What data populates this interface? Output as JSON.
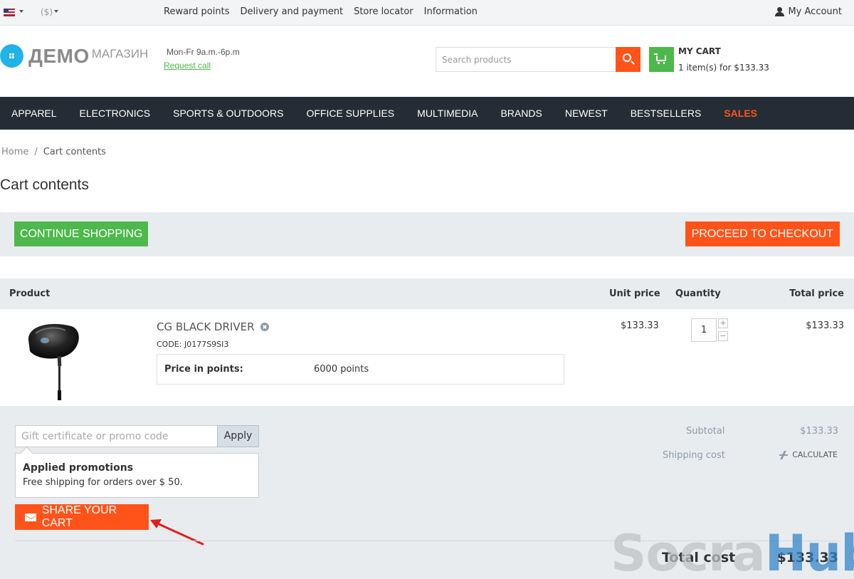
{
  "topbar": {
    "currency": "($)",
    "links": [
      "Reward points",
      "Delivery and payment",
      "Store locator",
      "Information"
    ],
    "account": "My Account"
  },
  "header": {
    "logo_main": "ДЕМО",
    "logo_sub": "МАГАЗИН",
    "hours": "Mon-Fr 9a.m.-6p.m",
    "request_call": "Request call",
    "search_placeholder": "Search products",
    "cart_title": "MY CART",
    "cart_summary": "1 item(s) for $133.33"
  },
  "nav": {
    "items": [
      "APPAREL",
      "ELECTRONICS",
      "SPORTS & OUTDOORS",
      "OFFICE SUPPLIES",
      "MULTIMEDIA",
      "BRANDS",
      "NEWEST",
      "BESTSELLERS",
      "SALES"
    ]
  },
  "breadcrumb": {
    "home": "Home",
    "separator": "/",
    "current": "Cart contents"
  },
  "page_title": "Cart contents",
  "actions": {
    "continue": "CONTINUE SHOPPING",
    "checkout": "PROCEED TO CHECKOUT"
  },
  "table": {
    "headers": {
      "product": "Product",
      "unit_price": "Unit price",
      "quantity": "Quantity",
      "total_price": "Total price"
    },
    "row": {
      "name": "CG BLACK DRIVER",
      "code": "CODE: J0177S9SI3",
      "points_label": "Price in points:",
      "points_value": "6000 points",
      "unit_price": "$133.33",
      "quantity": "1",
      "plus": "+",
      "minus": "−",
      "total_price": "$133.33"
    }
  },
  "promo": {
    "placeholder": "Gift certificate or promo code",
    "apply": "Apply",
    "applied_title": "Applied promotions",
    "applied_text": "Free shipping for orders over $ 50."
  },
  "share": {
    "label": "SHARE YOUR CART"
  },
  "totals": {
    "subtotal_label": "Subtotal",
    "subtotal_value": "$133.33",
    "shipping_label": "Shipping cost",
    "calculate": "CALCULATE",
    "total_label": "Total cost",
    "total_value": "$133.33"
  },
  "watermark": {
    "part1": "Socra",
    "part2": "Hub"
  },
  "colors": {
    "accent_orange": "#ff5319",
    "accent_green": "#4db84b",
    "nav_bg": "#242d35",
    "panel_bg": "#e9ecef"
  }
}
